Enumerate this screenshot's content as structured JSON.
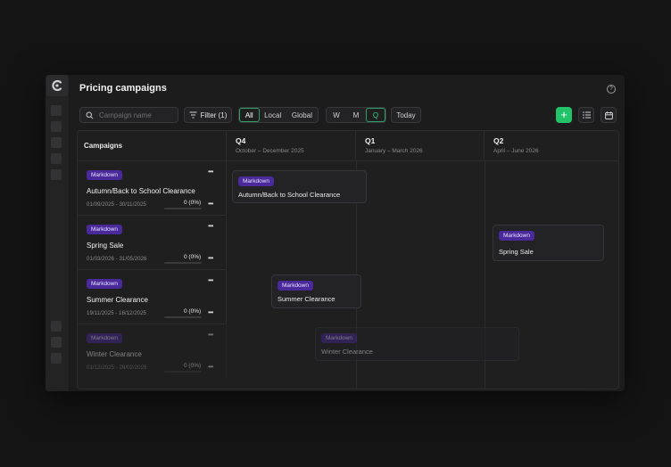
{
  "app": {
    "title": "Pricing campaigns"
  },
  "toolbar": {
    "search_placeholder": "Campaign name",
    "filter_label": "Filter (1)",
    "scope_options": [
      "All",
      "Local",
      "Global"
    ],
    "scope_selected": "All",
    "period_options": [
      "W",
      "M",
      "Q"
    ],
    "period_selected": "Q",
    "today_label": "Today",
    "add_label": "+"
  },
  "timeline": {
    "campaigns_header": "Campaigns",
    "quarters": [
      {
        "label": "Q4",
        "range": "October – December 2025"
      },
      {
        "label": "Q1",
        "range": "January – March 2026"
      },
      {
        "label": "Q2",
        "range": "April – June 2026"
      }
    ]
  },
  "campaigns": [
    {
      "badge": "Markdown",
      "name": "Autumn/Back to School Clearance",
      "dates": "01/09/2025 - 30/11/2025",
      "progress": "0 (0%)",
      "progress_fraction": 0
    },
    {
      "badge": "Markdown",
      "name": "Spring Sale",
      "dates": "01/03/2026 - 31/05/2026",
      "progress": "0 (0%)",
      "progress_fraction": 0
    },
    {
      "badge": "Markdown",
      "name": "Summer Clearance",
      "dates": "19/11/2025 - 16/12/2025",
      "progress": "0 (0%)",
      "progress_fraction": 0
    },
    {
      "badge": "Markdown",
      "name": "Winter Clearance",
      "dates": "01/12/2025 - 28/02/2026",
      "progress": "0 (0%)",
      "progress_fraction": 0
    }
  ],
  "blocks": [
    {
      "badge": "Markdown",
      "name": "Autumn/Back to School Clearance"
    },
    {
      "badge": "Markdown",
      "name": "Spring Sale"
    },
    {
      "badge": "Markdown",
      "name": "Summer Clearance"
    },
    {
      "badge": "Markdown",
      "name": "Winter Clearance"
    }
  ],
  "colors": {
    "accent": "#22c268",
    "badge": "#4a2a9a",
    "background": "#141414"
  },
  "icons": [
    "logo-icon",
    "search-icon",
    "filter-icon",
    "help-icon",
    "plus-icon",
    "list-view-icon",
    "calendar-icon",
    "more-icon"
  ]
}
